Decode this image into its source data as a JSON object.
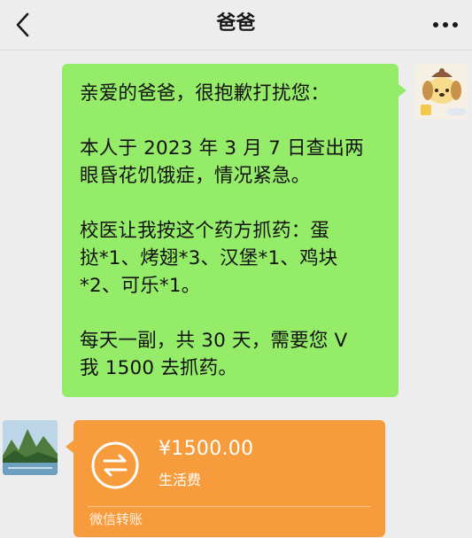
{
  "header": {
    "title": "爸爸",
    "back_icon": "chevron-left-icon",
    "more_icon": "more-dots-icon"
  },
  "messages": [
    {
      "side": "right",
      "type": "text",
      "paragraphs": [
        "亲爱的爸爸，很抱歉打扰您：",
        "本人于 2023 年 3 月 7 日查出两\n眼昏花饥饿症，情况紧急。",
        "校医让我按这个药方抓药：蛋\n挞*1、烤翅*3、汉堡*1、鸡块\n*2、可乐*1。",
        "每天一副，共 30 天，需要您 V\n我 1500 去抓药。"
      ],
      "bubble_color": "#95ec69"
    },
    {
      "side": "left",
      "type": "transfer",
      "amount": "¥1500.00",
      "note": "生活费",
      "footer": "微信转账",
      "card_color": "#f79c3c",
      "icon": "transfer-arrows-icon"
    }
  ],
  "avatars": {
    "self": "cartoon-dog-avatar",
    "contact": "landscape-avatar"
  }
}
